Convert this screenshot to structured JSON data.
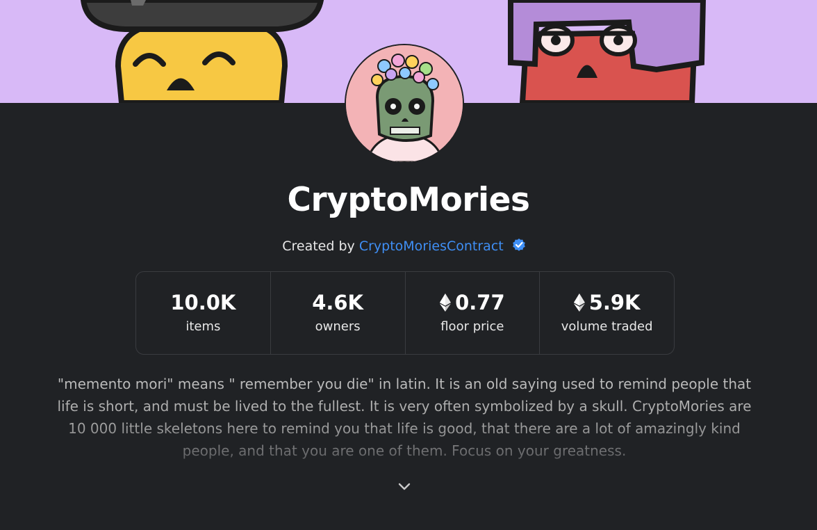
{
  "collection": {
    "name": "CryptoMories",
    "created_by_prefix": "Created by",
    "creator_name": "CryptoMoriesContract",
    "creator_verified": true,
    "description": "\"memento mori\" means \" remember you die\" in latin. It is an old saying used to remind people that life is short, and must be lived to the fullest. It is very often symbolized by a skull. CryptoMories are 10 000 little skeletons here to remind you that life is good, that there are a lot of amazingly kind people, and that you are one of them. Focus on your greatness."
  },
  "stats": [
    {
      "value": "10.0K",
      "label": "items",
      "icon": ""
    },
    {
      "value": "4.6K",
      "label": "owners",
      "icon": ""
    },
    {
      "value": "0.77",
      "label": "floor price",
      "icon": "ethereum-icon"
    },
    {
      "value": "5.9K",
      "label": "volume traded",
      "icon": "ethereum-icon"
    }
  ],
  "colors": {
    "banner": "#d8b9f7",
    "background": "#202225",
    "link": "#3f8ff5",
    "avatar_bg": "#f3b3b6"
  },
  "icons": {
    "verified": "verified-badge-icon",
    "expand": "chevron-down-icon"
  }
}
